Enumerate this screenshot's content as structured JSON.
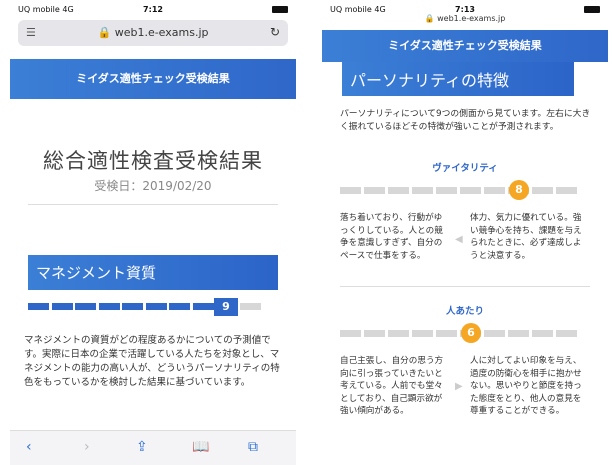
{
  "left": {
    "status": {
      "carrier": "UQ mobile 4G",
      "time": "7:12",
      "icons": "◡ ▢"
    },
    "urlbar": {
      "menu_icon": "text-size-icon",
      "url": "web1.e-exams.jp",
      "reload_icon": "reload-icon"
    },
    "banner": "ミイダス適性チェック受検結果",
    "title": "総合適性検査受検結果",
    "date": "受検日：2019/02/20",
    "section": "マネジメント資質",
    "score": "9",
    "score_value": 9,
    "description": "マネジメントの資質がどの程度あるかについての予測値です。実際に日本の企業で活躍している人たちを対象とし、マネジメントの能力の高い人が、どういうパーソナリティの特色をもっているかを検討した結果に基づいています。",
    "toolbar": {
      "back": "‹",
      "forward": "›",
      "share": "⇪",
      "bookmarks": "📖",
      "tabs": "⧉"
    }
  },
  "right": {
    "status": {
      "carrier": "UQ mobile 4G",
      "time": "7:13",
      "icons": "◡ ▢"
    },
    "url": "web1.e-exams.jp",
    "banner": "ミイダス適性チェック受検結果",
    "heading": "パーソナリティの特徴",
    "intro": "パーソナリティについて9つの側面から見ています。左右に大きく振れているほどその特徴が強いことが予測されます。",
    "traits": [
      {
        "name": "ヴァイタリティ",
        "score": "8",
        "score_value": 8,
        "left_text": "落ち着いており、行動がゆっくりしている。人との競争を意識しすぎず、自分のペースで仕事をする。",
        "right_text": "体力、気力に優れている。強い競争心を持ち、課題を与えられたときに、必ず達成しようと決意する。"
      },
      {
        "name": "人あたり",
        "score": "6",
        "score_value": 6,
        "left_text": "自己主張し、自分の思う方向に引っ張っていきたいと考えている。人前でも堂々としており、自己顕示欲が強い傾向がある。",
        "right_text": "人に対してよい印象を与え、過度の防衛心を相手に抱かせない。思いやりと節度を持った態度をとり、他人の意見を尊重することができる。"
      }
    ]
  },
  "colors": {
    "blue": "#2f67c9",
    "orange": "#f5a623",
    "grey": "#d7d7d7"
  }
}
